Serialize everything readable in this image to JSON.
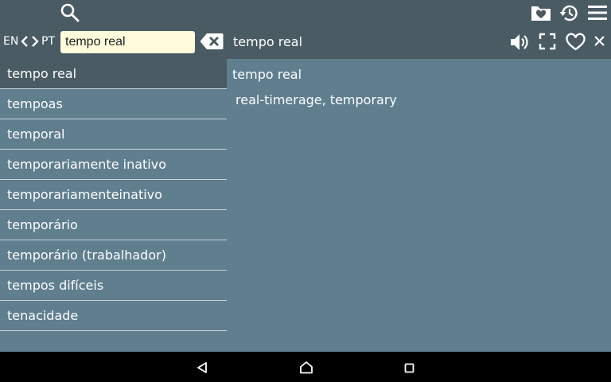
{
  "languages": {
    "source": "EN",
    "target": "PT"
  },
  "search": {
    "value": "tempo real"
  },
  "header": {
    "word": "tempo real"
  },
  "results": [
    {
      "label": "tempo real"
    },
    {
      "label": "tempoas"
    },
    {
      "label": "temporal"
    },
    {
      "label": "temporariamente inativo"
    },
    {
      "label": "temporariamenteinativo"
    },
    {
      "label": "temporário"
    },
    {
      "label": "temporário (trabalhador)"
    },
    {
      "label": "tempos difíceis"
    },
    {
      "label": "tenacidade"
    }
  ],
  "detail": {
    "word": "tempo real",
    "definition": "real-timerage, temporary"
  },
  "colors": {
    "toolbar": "#4a5b63",
    "background": "#5f7e8e",
    "search_field": "#fffbdc",
    "navbar": "#000000"
  },
  "icons": {
    "search": "search-icon",
    "favorites_folder": "heart-folder-icon",
    "history": "history-icon",
    "menu": "hamburger-menu-icon",
    "swap_left": "chevron-left-icon",
    "swap_right": "chevron-right-icon",
    "clear": "backspace-clear-icon",
    "speaker": "speaker-icon",
    "fullscreen": "fullscreen-icon",
    "favorite": "heart-outline-icon",
    "close": "close-icon",
    "nav_back": "nav-back-icon",
    "nav_home": "nav-home-icon",
    "nav_recents": "nav-recents-icon"
  }
}
